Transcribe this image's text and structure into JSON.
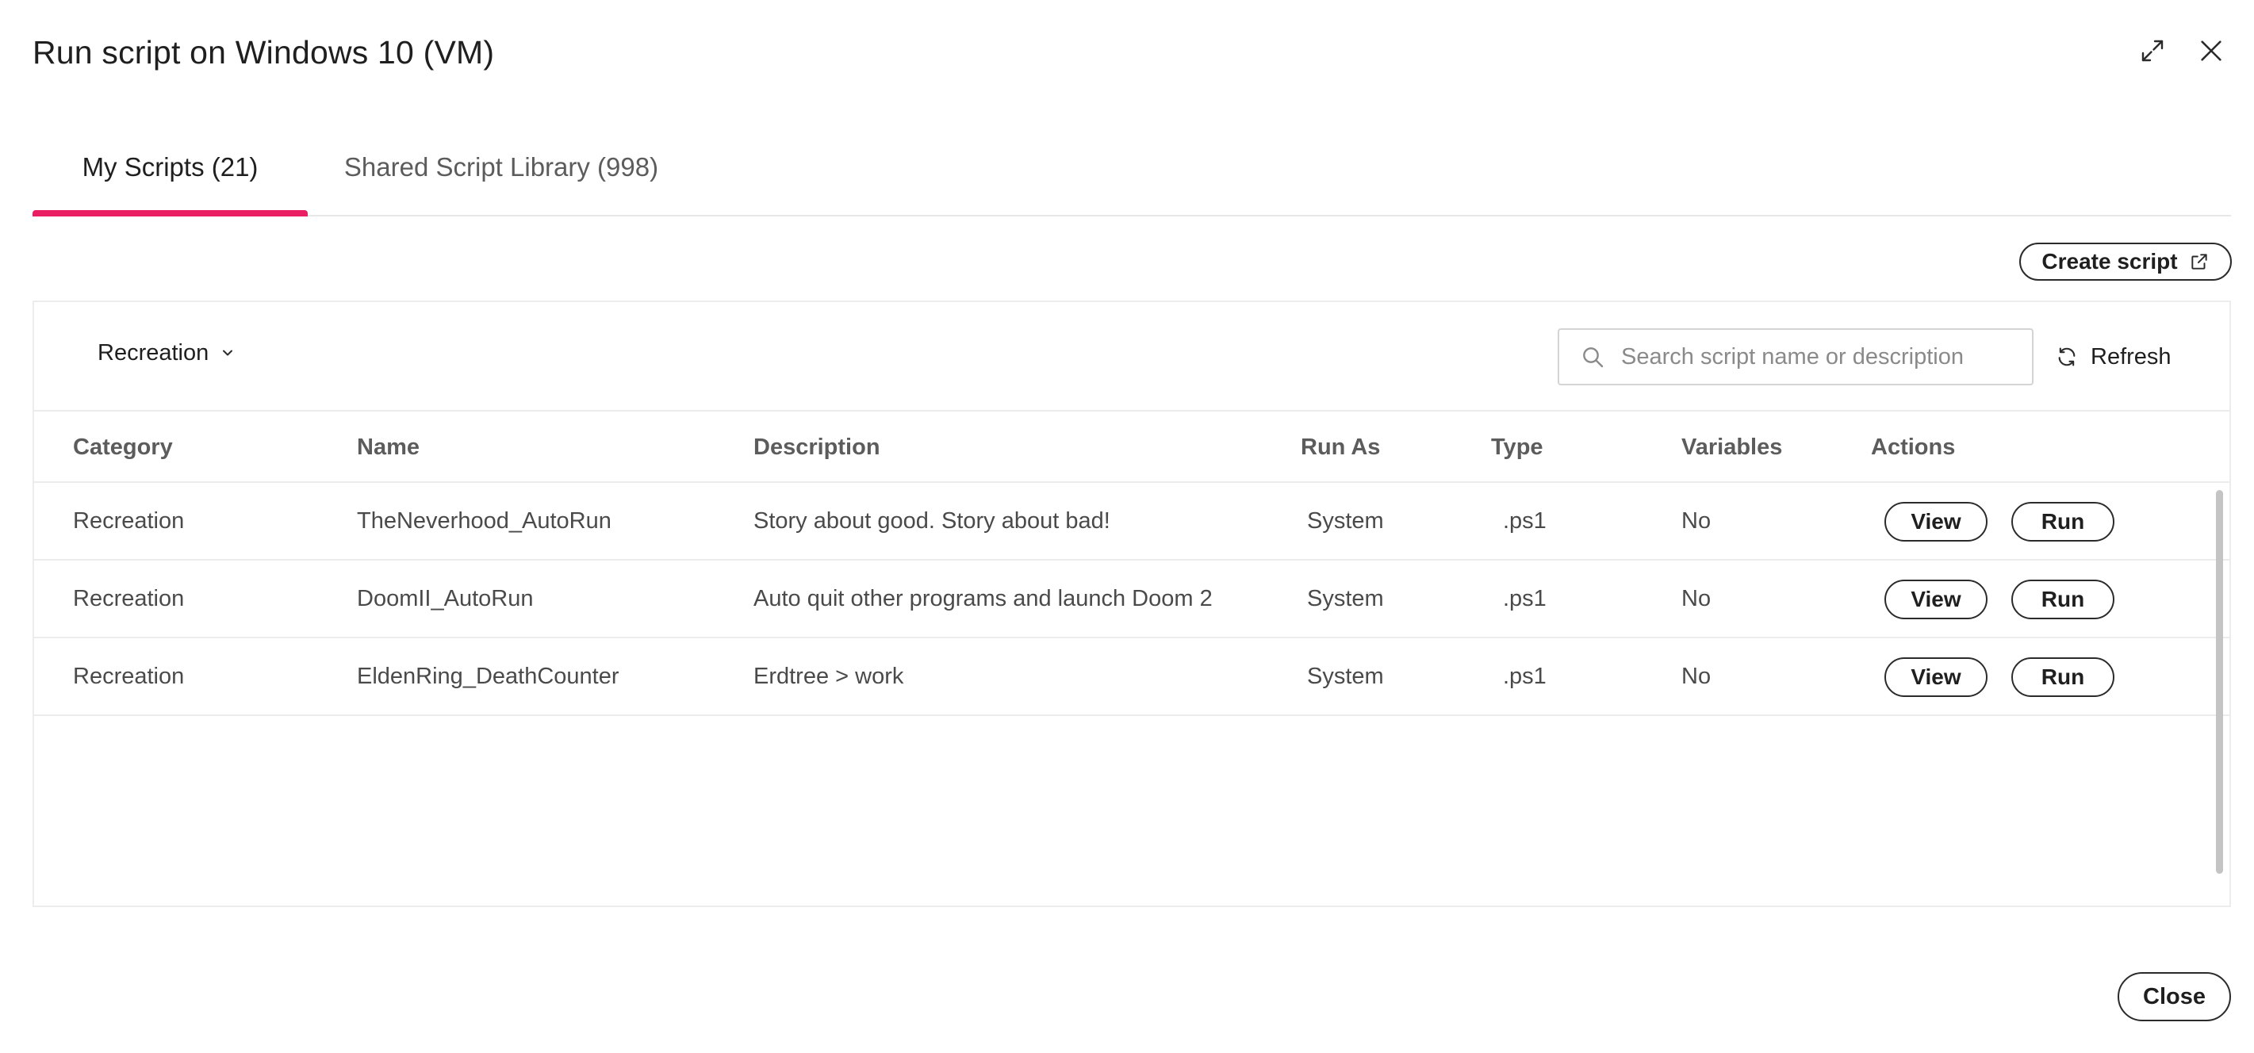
{
  "dialog": {
    "title": "Run script on Windows 10 (VM)",
    "icons": {
      "expand": "expand-icon",
      "close": "close-icon"
    }
  },
  "tabs": [
    {
      "label": "My Scripts (21)",
      "active": true
    },
    {
      "label": "Shared Script Library (998)",
      "active": false
    }
  ],
  "accent_color": "#e91e63",
  "toolbar": {
    "create_script_label": "Create script",
    "create_script_icon": "external-link-icon",
    "filter_value": "Recreation",
    "filter_icon": "chevron-down-icon",
    "search_placeholder": "Search script name or description",
    "search_value": "",
    "search_icon": "search-icon",
    "refresh_label": "Refresh",
    "refresh_icon": "refresh-icon"
  },
  "table": {
    "headers": {
      "category": "Category",
      "name": "Name",
      "description": "Description",
      "run_as": "Run As",
      "type": "Type",
      "variables": "Variables",
      "actions": "Actions"
    },
    "rows": [
      {
        "category": "Recreation",
        "name": "TheNeverhood_AutoRun",
        "description": "Story about good. Story about bad!",
        "run_as": "System",
        "type": ".ps1",
        "variables": "No",
        "view_label": "View",
        "run_label": "Run"
      },
      {
        "category": "Recreation",
        "name": "DoomII_AutoRun",
        "description": "Auto quit other programs and launch Doom 2",
        "run_as": "System",
        "type": ".ps1",
        "variables": "No",
        "view_label": "View",
        "run_label": "Run"
      },
      {
        "category": "Recreation",
        "name": "EldenRing_DeathCounter",
        "description": "Erdtree > work",
        "run_as": "System",
        "type": ".ps1",
        "variables": "No",
        "view_label": "View",
        "run_label": "Run"
      }
    ]
  },
  "footer": {
    "close_label": "Close"
  }
}
